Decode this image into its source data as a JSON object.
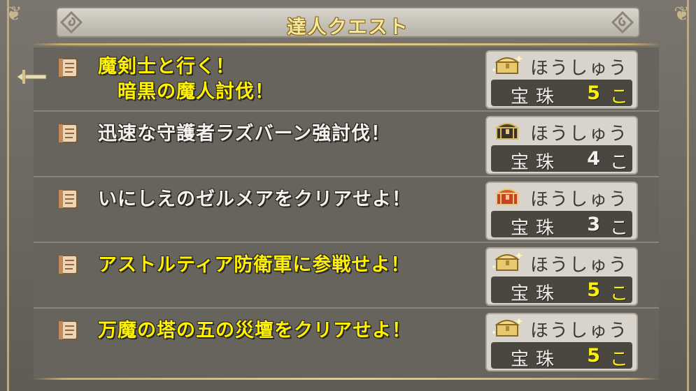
{
  "title": "達人クエスト",
  "reward_label": "ほうしゅう",
  "quests": [
    {
      "lines": [
        "魔剣士と行く！",
        "　暗黒の魔人討伐！"
      ],
      "style": "yellow",
      "reward_name": "宝珠",
      "qty": "5",
      "unit": "こ",
      "qty_style": "yellow",
      "chest": "gold-sparkle-chest"
    },
    {
      "lines": [
        "迅速な守護者ラズバーン強討伐！"
      ],
      "style": "white",
      "reward_name": "宝珠",
      "qty": "4",
      "unit": "こ",
      "qty_style": "white",
      "chest": "black-gold-chest"
    },
    {
      "lines": [
        "いにしえのゼルメアをクリアせよ！"
      ],
      "style": "white",
      "reward_name": "宝珠",
      "qty": "3",
      "unit": "こ",
      "qty_style": "white",
      "chest": "red-chest"
    },
    {
      "lines": [
        "アストルティア防衛軍に参戦せよ！"
      ],
      "style": "yellow",
      "reward_name": "宝珠",
      "qty": "5",
      "unit": "こ",
      "qty_style": "yellow",
      "chest": "gold-sparkle-chest"
    },
    {
      "lines": [
        "万魔の塔の五の災壇をクリアせよ！"
      ],
      "style": "yellow",
      "reward_name": "宝珠",
      "qty": "5",
      "unit": "こ",
      "qty_style": "yellow",
      "chest": "gold-sparkle-chest"
    }
  ],
  "colors": {
    "yellow": "#fff200",
    "white": "#f4f2ee",
    "panel": "#67635d",
    "reward_bg": "#d8d4cc",
    "reward_dark": "#4a4741"
  }
}
